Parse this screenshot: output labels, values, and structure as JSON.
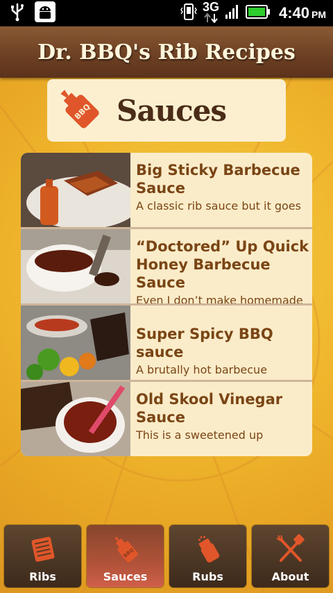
{
  "status_bar": {
    "network": "3G",
    "time": "4:40",
    "ampm": "PM",
    "icons": [
      "usb-icon",
      "android-debug-icon",
      "vibrate-icon",
      "signal-icon",
      "battery-icon"
    ]
  },
  "header": {
    "title": "Dr. BBQ's Rib Recipes"
  },
  "section": {
    "title": "Sauces",
    "icon": "bbq-bottle-icon",
    "icon_label": "BBQ"
  },
  "recipes": [
    {
      "title": "Big Sticky Barbecue Sauce",
      "description": "A classic rib sauce but it goes"
    },
    {
      "title": "“Doctored” Up Quick Honey Barbecue Sauce",
      "description": "Even I don’t make homemade"
    },
    {
      "title": "Super Spicy BBQ sauce",
      "description": "A brutally hot barbecue"
    },
    {
      "title": "Old Skool Vinegar Sauce",
      "description": "This is a sweetened up"
    }
  ],
  "tabs": [
    {
      "label": "Ribs",
      "icon": "ribs-icon",
      "active": false
    },
    {
      "label": "Sauces",
      "icon": "sauce-bottle-icon",
      "active": true
    },
    {
      "label": "Rubs",
      "icon": "rub-shaker-icon",
      "active": false
    },
    {
      "label": "About",
      "icon": "grill-tools-icon",
      "active": false
    }
  ],
  "colors": {
    "accent": "#7a4515",
    "header_bg": "#6e4124",
    "list_bg": "#fbecc9",
    "active_tab": "#c0573f",
    "icon_orange": "#e0562a"
  }
}
